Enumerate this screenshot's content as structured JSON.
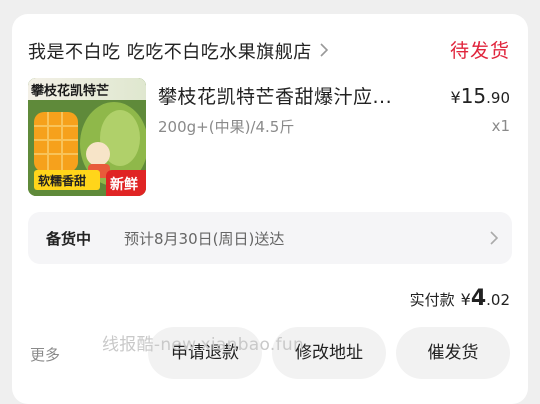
{
  "order": {
    "shop_name": "我是不白吃 吃吃不白吃水果旗舰店",
    "status": "待发货",
    "thumb": {
      "title": "攀枝花凯特芒",
      "tag_left": "软糯香甜",
      "tag_right": "新鲜"
    },
    "product_title": "攀枝花凯特芒香甜爆汁应...",
    "price": {
      "currency": "¥",
      "integer": "15",
      "decimal": ".90"
    },
    "spec": "200g+(中果)/4.5斤",
    "quantity": "x1",
    "shipping": {
      "status": "备货中",
      "eta": "预计8月30日(周日)送达"
    },
    "paid": {
      "label": "实付款",
      "currency": "¥",
      "integer": "4",
      "decimal": ".02"
    }
  },
  "actions": {
    "more": "更多",
    "refund": "申请退款",
    "change_address": "修改地址",
    "remind": "催发货"
  },
  "watermark": "线报酷-new.xianbao.fun",
  "colors": {
    "status": "#e0243c",
    "card_bg": "#ffffff",
    "page_bg": "#efefef"
  }
}
